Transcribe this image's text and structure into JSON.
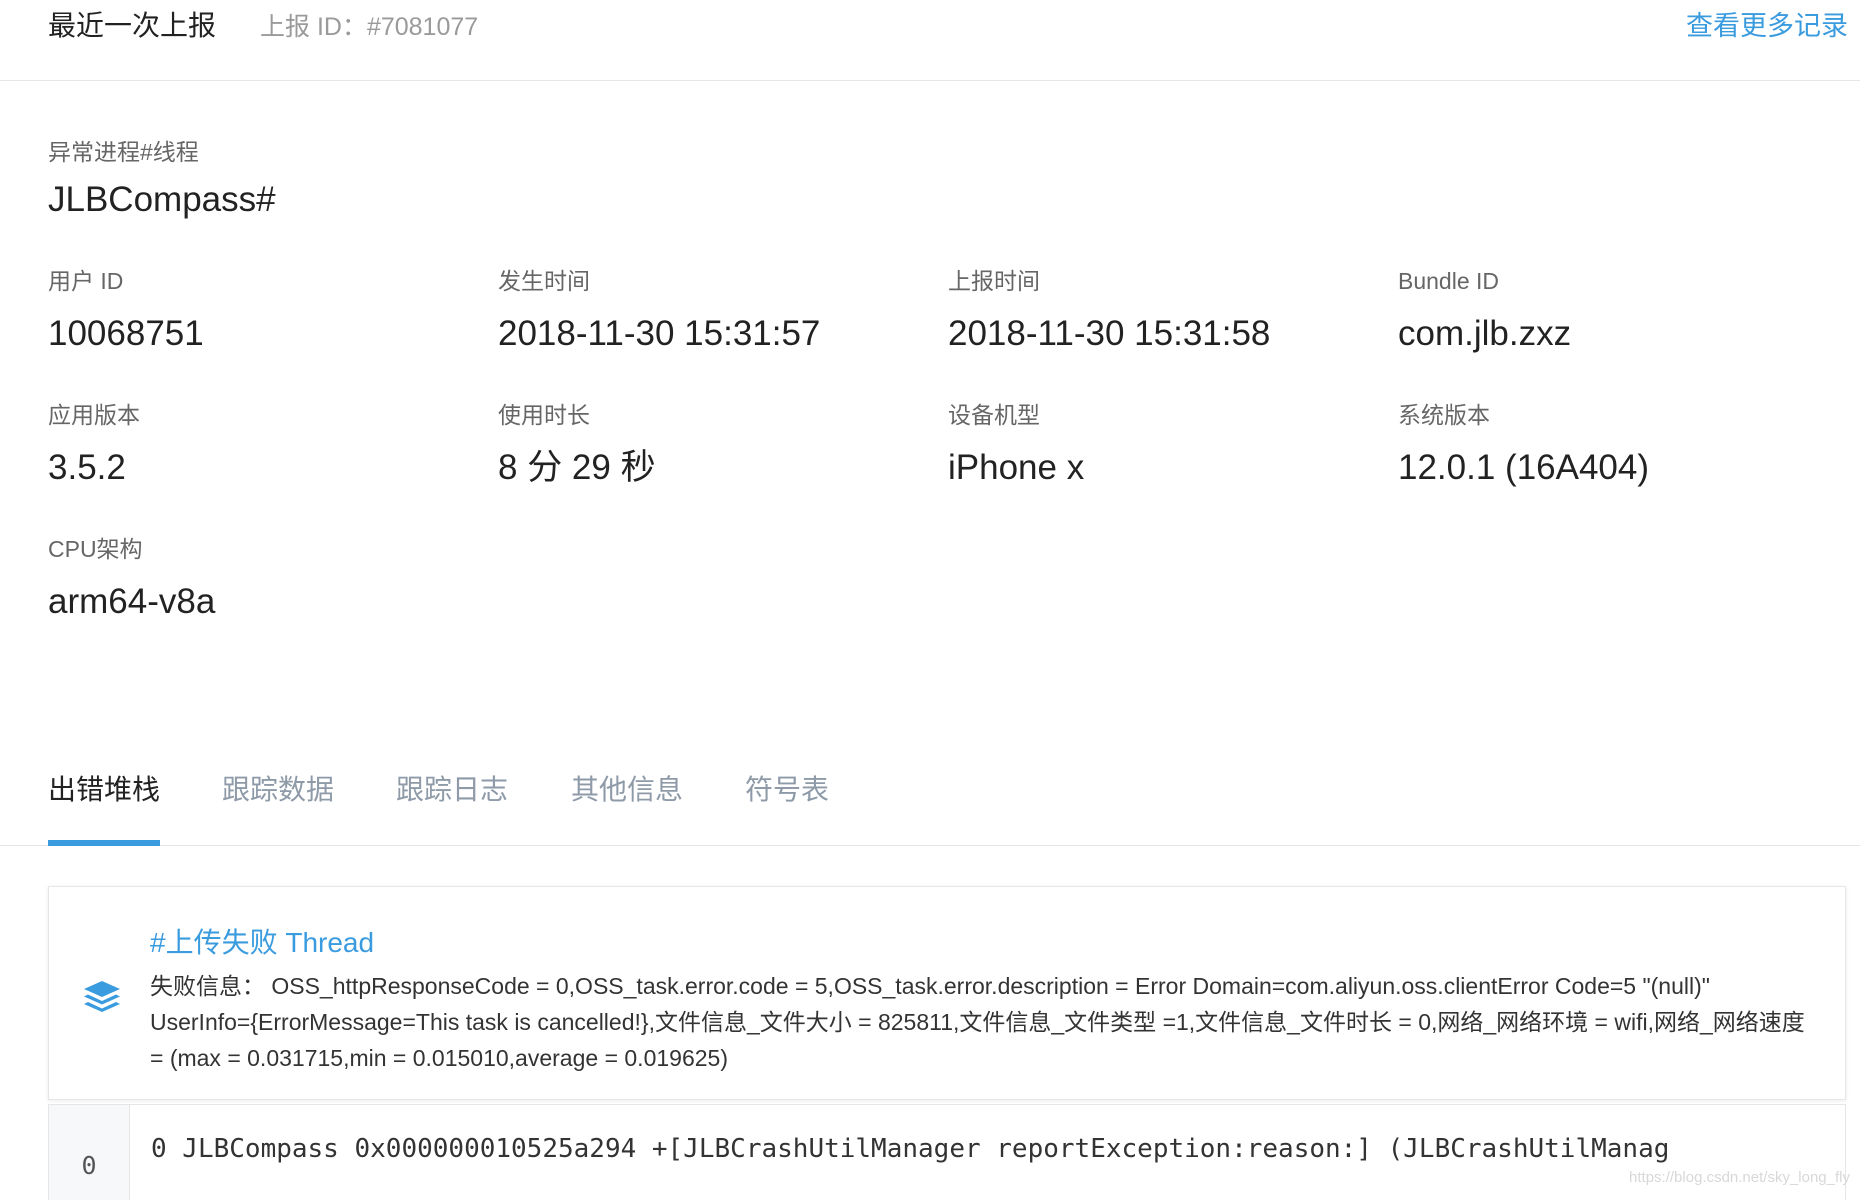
{
  "header": {
    "title": "最近一次上报",
    "report_id": "上报 ID：#7081077",
    "more_link": "查看更多记录"
  },
  "process": {
    "label": "异常进程#线程",
    "value": "JLBCompass#"
  },
  "fields": {
    "user_id": {
      "label": "用户 ID",
      "value": "10068751"
    },
    "occur_time": {
      "label": "发生时间",
      "value": "2018-11-30 15:31:57"
    },
    "report_time": {
      "label": "上报时间",
      "value": "2018-11-30 15:31:58"
    },
    "bundle_id": {
      "label": "Bundle ID",
      "value": "com.jlb.zxz"
    },
    "app_version": {
      "label": "应用版本",
      "value": "3.5.2"
    },
    "usage_duration": {
      "label": "使用时长",
      "value": "8 分 29 秒"
    },
    "device_model": {
      "label": "设备机型",
      "value": "iPhone x"
    },
    "os_version": {
      "label": "系统版本",
      "value": "12.0.1 (16A404)"
    },
    "cpu_arch": {
      "label": "CPU架构",
      "value": "arm64-v8a"
    }
  },
  "tabs": [
    {
      "label": "出错堆栈",
      "active": true
    },
    {
      "label": "跟踪数据",
      "active": false
    },
    {
      "label": "跟踪日志",
      "active": false
    },
    {
      "label": "其他信息",
      "active": false
    },
    {
      "label": "符号表",
      "active": false
    }
  ],
  "thread": {
    "icon": "layers-icon",
    "title": "#上传失败 Thread",
    "info": "失败信息： OSS_httpResponseCode = 0,OSS_task.error.code = 5,OSS_task.error.description = Error Domain=com.aliyun.oss.clientError Code=5 \"(null)\" UserInfo={ErrorMessage=This task is cancelled!},文件信息_文件大小 = 825811,文件信息_文件类型 =1,文件信息_文件时长 = 0,网络_网络环境 = wifi,网络_网络速度 = (max = 0.031715,min = 0.015010,average = 0.019625)"
  },
  "stack": [
    {
      "index": "0",
      "text": "0 JLBCompass 0x000000010525a294 +[JLBCrashUtilManager reportException:reason:] (JLBCrashUtilManag"
    }
  ],
  "watermark": "https://blog.csdn.net/sky_long_fly",
  "colors": {
    "accent": "#3a9bdf",
    "border": "#e6e6e6",
    "muted": "#8e9aa8"
  }
}
